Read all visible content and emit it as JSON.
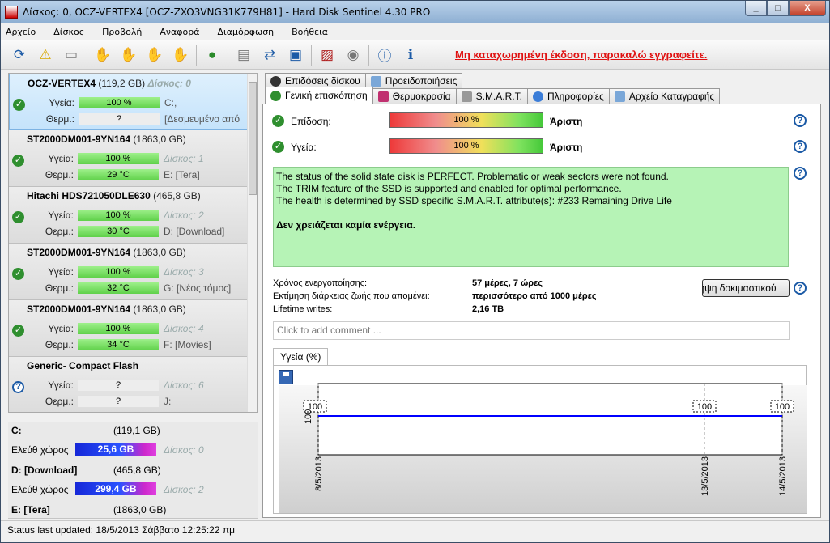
{
  "window": {
    "title": "Δίσκος: 0, OCZ-VERTEX4 [OCZ-ZXO3VNG31K779H81]  -  Hard Disk Sentinel 4.30 PRO",
    "minimize": "_",
    "maximize": "□",
    "close": "X"
  },
  "menu": [
    "Αρχείο",
    "Δίσκος",
    "Προβολή",
    "Αναφορά",
    "Διαμόρφωση",
    "Βοήθεια"
  ],
  "toolbar": {
    "icons": [
      "refresh-icon",
      "alert-icon",
      "disk-icon",
      "hand-icon",
      "hand-info-icon",
      "hand-ok-icon",
      "hand-alert-icon",
      "globe-icon",
      "document-icon",
      "sync-icon",
      "network-icon",
      "chart-icon",
      "speaker-icon",
      "help-icon",
      "info-icon"
    ],
    "registration_notice": "Μη καταχωρημένη έκδοση, παρακαλώ εγγραφείτε."
  },
  "disks": [
    {
      "name": "OCZ-VERTEX4",
      "size": "(119,2 GB)",
      "disk_no": "Δίσκος: 0",
      "health_label": "Υγεία:",
      "health": "100 %",
      "health_fill": 1.0,
      "health_extra": "C:,",
      "temp_label": "Θερμ.:",
      "temp": "?",
      "temp_extra": "[Δεσμευμένο από",
      "status": "ok"
    },
    {
      "name": "ST2000DM001-9YN164",
      "size": "(1863,0 GB)",
      "disk_no": "Δίσκος: 1",
      "health_label": "Υγεία:",
      "health": "100 %",
      "health_fill": 1.0,
      "temp_label": "Θερμ.:",
      "temp": "29 °C",
      "temp_extra": "E: [Tera]",
      "status": "ok"
    },
    {
      "name": "Hitachi HDS721050DLE630",
      "size": "(465,8 GB)",
      "disk_no": "Δίσκος: 2",
      "health_label": "Υγεία:",
      "health": "100 %",
      "health_fill": 1.0,
      "temp_label": "Θερμ.:",
      "temp": "30 °C",
      "temp_extra": "D: [Download]",
      "status": "ok"
    },
    {
      "name": "ST2000DM001-9YN164",
      "size": "(1863,0 GB)",
      "disk_no": "Δίσκος: 3",
      "health_label": "Υγεία:",
      "health": "100 %",
      "health_fill": 1.0,
      "temp_label": "Θερμ.:",
      "temp": "32 °C",
      "temp_extra": "G: [Νέος τόμος]",
      "status": "ok"
    },
    {
      "name": "ST2000DM001-9YN164",
      "size": "(1863,0 GB)",
      "disk_no": "Δίσκος: 4",
      "health_label": "Υγεία:",
      "health": "100 %",
      "health_fill": 1.0,
      "temp_label": "Θερμ.:",
      "temp": "34 °C",
      "temp_extra": "F: [Movies]",
      "status": "ok"
    },
    {
      "name": "Generic- Compact Flash",
      "size": "",
      "disk_no": "Δίσκος: 6",
      "health_label": "Υγεία:",
      "health": "?",
      "health_fill": 0,
      "temp_label": "Θερμ.:",
      "temp": "?",
      "temp_extra": "J:",
      "status": "unknown"
    }
  ],
  "volumes": [
    {
      "name": "C:",
      "size": "(119,1 GB)",
      "free_label": "Ελεύθ χώρος",
      "free": "25,6 GB",
      "disk": "Δίσκος: 0"
    },
    {
      "name": "D: [Download]",
      "size": "(465,8 GB)",
      "free_label": "Ελεύθ χώρος",
      "free": "299,4 GB",
      "disk": "Δίσκος: 2"
    },
    {
      "name": "E: [Tera]",
      "size": "(1863,0 GB)"
    }
  ],
  "status_bar": "Status last updated: 18/5/2013 Σάββατο 12:25:22 πμ",
  "tabs_row1": [
    "Επιδόσεις δίσκου",
    "Προειδοποιήσεις"
  ],
  "tabs_row2": [
    "Γενική επισκόπηση",
    "Θερμοκρασία",
    "S.M.A.R.T.",
    "Πληροφορίες",
    "Αρχείο Καταγραφής"
  ],
  "overview": {
    "performance_label": "Επίδοση:",
    "performance_value": "100 %",
    "performance_rating": "Άριστη",
    "health_label": "Υγεία:",
    "health_value": "100 %",
    "health_rating": "Άριστη",
    "message_lines": [
      "The status of the solid state disk is PERFECT. Problematic or weak sectors were not found.",
      "The TRIM feature of the SSD is supported and enabled for optimal performance.",
      "The health is determined by SSD specific S.M.A.R.T. attribute(s):  #233 Remaining Drive Life"
    ],
    "message_action": "Δεν χρειάζεται καμία ενέργεια.",
    "power_on_label": "Χρόνος ενεργοποίησης:",
    "power_on_value": "57 μέρες, 7 ώρες",
    "lifetime_est_label": "Εκτίμηση διάρκειας ζωής που απομένει:",
    "lifetime_est_value": "περισσότερο από 1000 μέρες",
    "lifetime_writes_label": "Lifetime writes:",
    "lifetime_writes_value": "2,16 TB",
    "test_button": "Λήψη δοκιμαστικού",
    "comment_placeholder": "Click to add comment ...",
    "graph_tab": "Υγεία (%)",
    "help_glyph": "?"
  },
  "chart_data": {
    "type": "line",
    "x": [
      "8/5/2013",
      "13/5/2013",
      "14/5/2013"
    ],
    "series": [
      {
        "values": [
          100,
          100,
          100
        ]
      }
    ],
    "ylabel_tick": "100",
    "line_color": "#0000ff"
  }
}
